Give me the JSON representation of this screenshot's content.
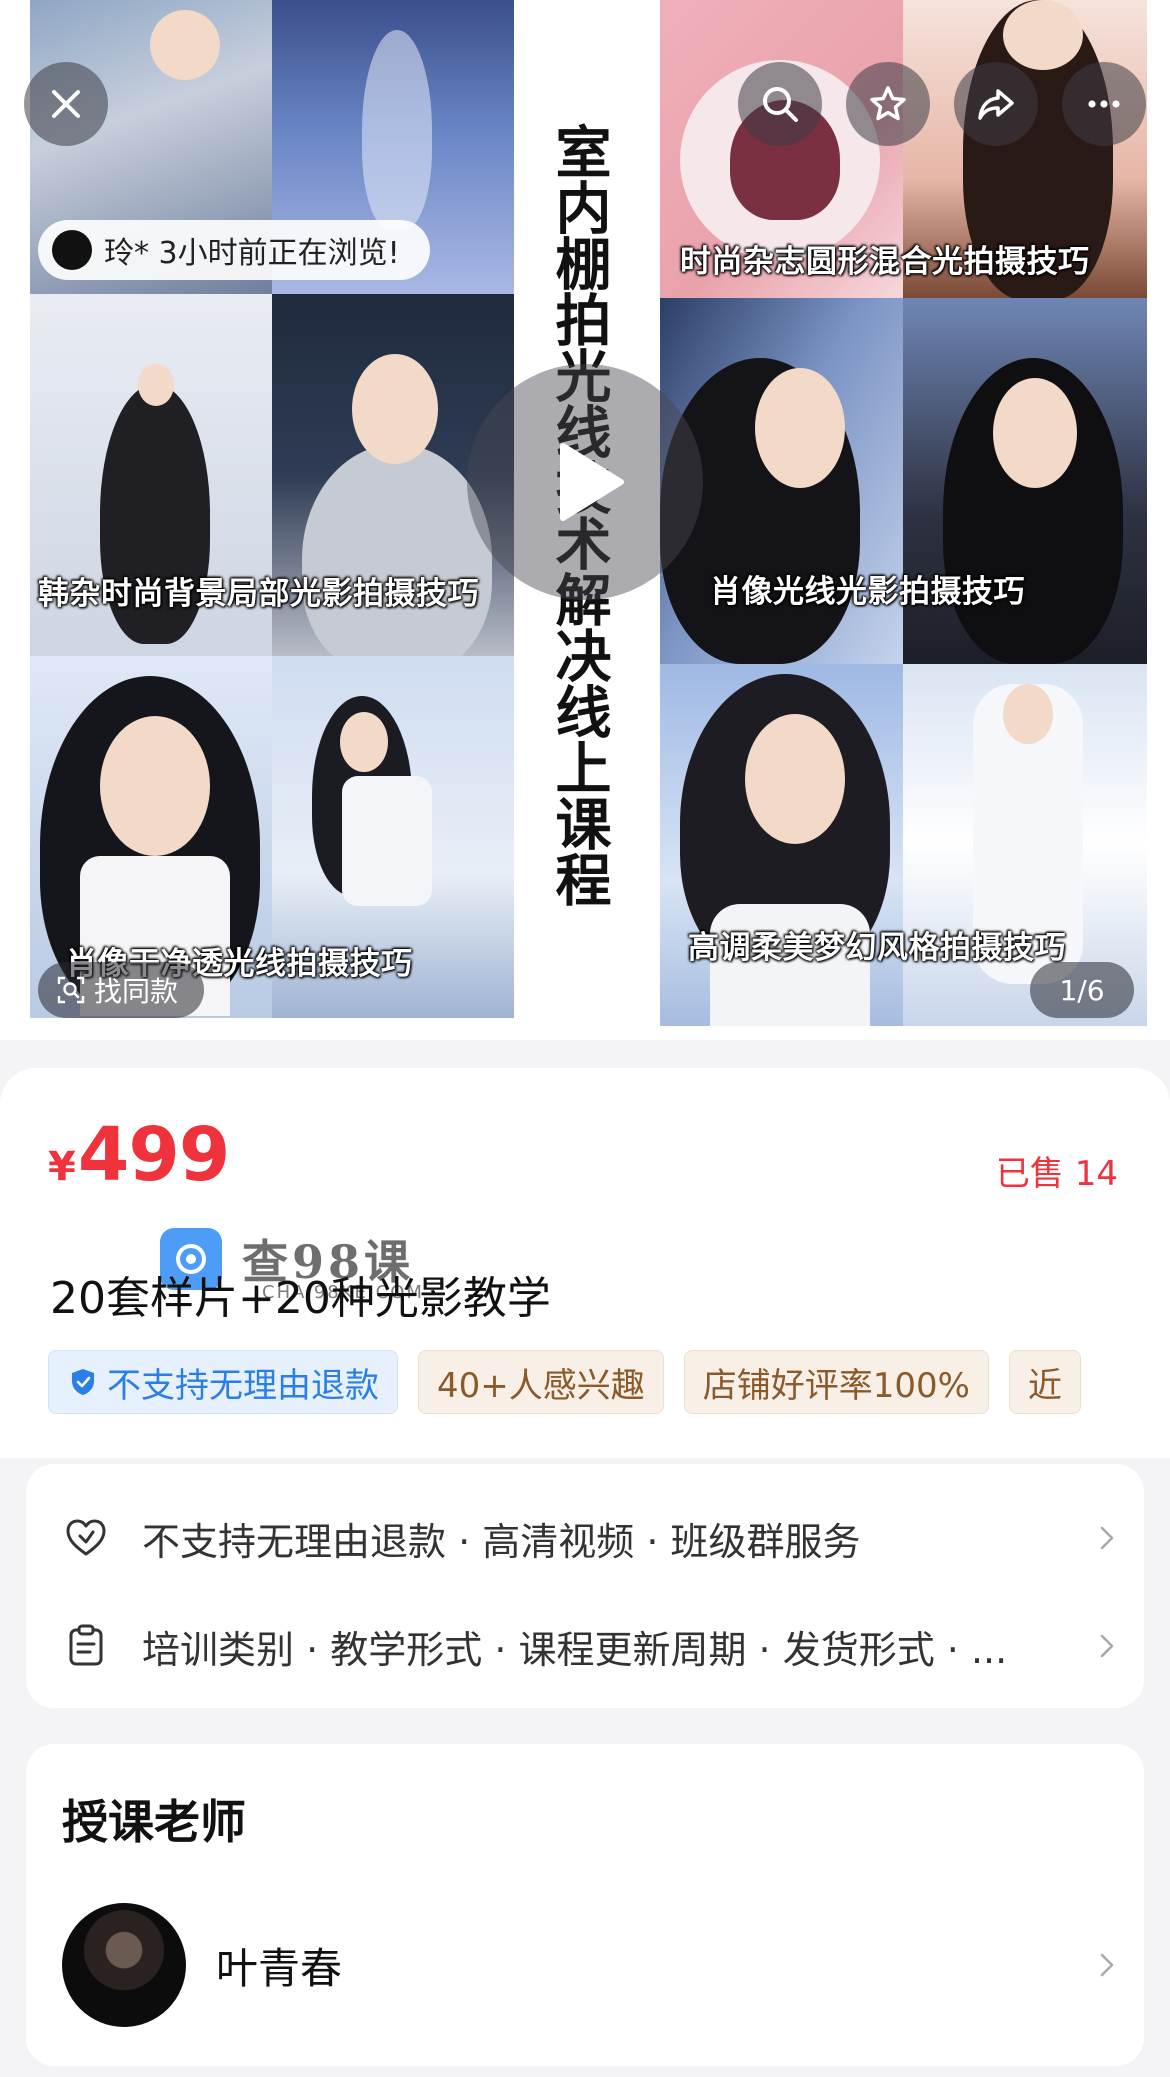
{
  "hero": {
    "vertical_title": "室内棚拍光线技术解决线上课程",
    "viewer_text": "玲* 3小时前正在浏览!",
    "find_same_label": "找同款",
    "page_counter": "1/6",
    "captions": {
      "top_right": "时尚杂志圆形混合光拍摄技巧",
      "mid_left": "韩杂时尚背景局部光影拍摄技巧",
      "mid_right": "肖像光线光影拍摄技巧",
      "bottom_left": "肖像干净透光线拍摄技巧",
      "bottom_right": "高调柔美梦幻风格拍摄技巧"
    },
    "icons": [
      "close-icon",
      "search-icon",
      "star-icon",
      "share-icon",
      "more-icon",
      "play-icon"
    ]
  },
  "product": {
    "currency_symbol": "¥",
    "price": "499",
    "sold_label": "已售 14",
    "title": "20套样片+20种光影教学",
    "watermark_text": "查98课",
    "watermark_sub": "CHA.98KE.COM",
    "tags": [
      {
        "label": "不支持无理由退款",
        "style": "blue",
        "icon": "shield-check-icon"
      },
      {
        "label": "40+人感兴趣",
        "style": "brown"
      },
      {
        "label": "店铺好评率100%",
        "style": "brown"
      },
      {
        "label": "近",
        "style": "brown"
      }
    ]
  },
  "services": {
    "row1": "不支持无理由退款 · 高清视频 · 班级群服务",
    "row2": "培训类别 · 教学形式 · 课程更新周期 · 发货形式 · ..."
  },
  "teacher": {
    "heading": "授课老师",
    "name": "叶青春"
  },
  "colors": {
    "price_red": "#f0323c",
    "tag_blue": "#2a7ee6",
    "tag_brown": "#8a5a2b"
  }
}
